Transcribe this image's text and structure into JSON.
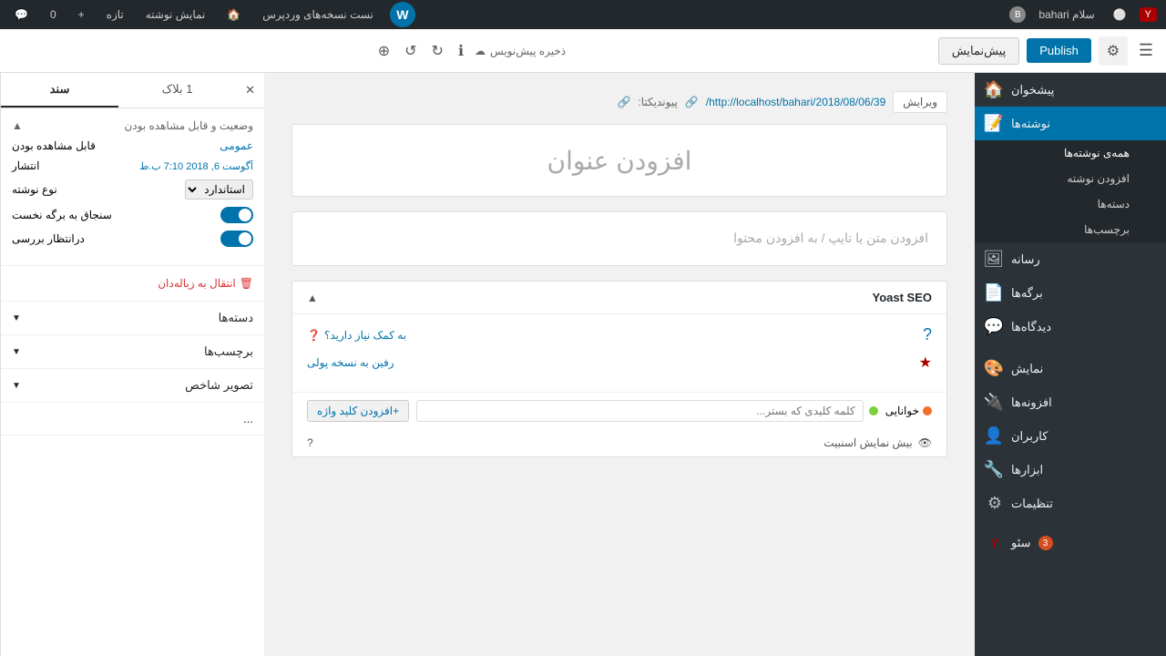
{
  "admin_bar": {
    "wp_logo": "W",
    "site_name": "نست نسخه‌های وردپرس",
    "home_icon": "🏠",
    "view_site": "نمایش نوشته",
    "customize": "تازه",
    "comment_count": "0",
    "plus_label": "+",
    "user_name": "سلام bahari",
    "user_avatar": "B",
    "yoast_icon": "Y",
    "circle_icon": "⚪"
  },
  "editor_toolbar": {
    "hamburger": "☰",
    "settings_label": "⚙",
    "publish_label": "Publish",
    "preview_label": "پیش‌نمایش",
    "save_label": "ذخیره پیش‌نویس",
    "cloud_icon": "☁",
    "info_icon": "ℹ",
    "redo_icon": "↻",
    "undo_icon": "↺",
    "plus_icon": "⊕"
  },
  "sidebar": {
    "items": [
      {
        "id": "dashboard",
        "label": "پیشخوان",
        "icon": "🏠",
        "active": false
      },
      {
        "id": "posts",
        "label": "نوشته‌ها",
        "icon": "📝",
        "active": true
      },
      {
        "id": "media",
        "label": "رسانه",
        "icon": "🖼",
        "active": false
      },
      {
        "id": "pages",
        "label": "برگه‌ها",
        "icon": "📄",
        "active": false
      },
      {
        "id": "comments",
        "label": "دیدگاه‌ها",
        "icon": "💬",
        "active": false
      },
      {
        "id": "appearance",
        "label": "نمایش",
        "icon": "🎨",
        "active": false
      },
      {
        "id": "plugins",
        "label": "افزونه‌ها",
        "icon": "🔌",
        "active": false
      },
      {
        "id": "users",
        "label": "کاربران",
        "icon": "👤",
        "active": false
      },
      {
        "id": "tools",
        "label": "ابزارها",
        "icon": "🔧",
        "active": false
      },
      {
        "id": "settings",
        "label": "تنظیمات",
        "icon": "⚙",
        "active": false
      },
      {
        "id": "seo",
        "label": "سئو",
        "icon": "Y",
        "active": false,
        "badge": "3"
      }
    ],
    "posts_submenu": [
      {
        "id": "all-posts",
        "label": "همه‌ی نوشته‌ها",
        "active": true
      },
      {
        "id": "add-new",
        "label": "افزودن نوشته",
        "active": false
      },
      {
        "id": "categories",
        "label": "دسته‌ها",
        "active": false
      },
      {
        "id": "tags",
        "label": "برچسب‌ها",
        "active": false
      }
    ]
  },
  "panel": {
    "tab_document": "سند",
    "tab_block": "1 بلاک",
    "close_icon": "✕",
    "status_section": {
      "title": "وضعیت و قابل مشاهده بودن",
      "visibility_label": "قابل مشاهده بودن",
      "visibility_value": "عمومی",
      "publish_label": "انتشار",
      "publish_value": "آگوست 6, 2018 7:10 ب.ط",
      "post_type_label": "نوع نوشته",
      "post_type_value": "استاندارد ▼",
      "stick_label": "سنجاق به برگه نخست",
      "pending_label": "درانتظار بررسی"
    },
    "trash_label": "انتقال به زباله‌دان",
    "categories_label": "دسته‌ها",
    "tags_label": "برچسب‌ها",
    "image_label": "تصویر شاخص"
  },
  "editor": {
    "permalink_label": "پیوندیکتا:",
    "permalink_url": "http://localhost/bahari/2018/08/06/39/",
    "link_icon": "🔗",
    "external_icon": "🔗",
    "edit_btn": "ویرایش",
    "title_placeholder": "افزودن عنوان",
    "content_placeholder": "افزودن متن یا تایپ / به افزودن محتوا"
  },
  "yoast": {
    "title": "Yoast SEO",
    "toggle_arrow": "▲",
    "need_help_label": "به کمک نیاز دارید؟",
    "help_icon": "?",
    "star_icon": "★",
    "version_link": "رفین به نسخه پولی",
    "readability_label": "خوانایی",
    "readability_status": "orange",
    "keyword_label": "کلمه کلیدی که بستر...",
    "keyword_placeholder": "کلمه کلیدی که بستر...",
    "add_keyword_label": "+افزودن کلید واژه",
    "preview_label": "بیش نمایش اسنبیت",
    "preview_icon": "👁",
    "question_icon": "?"
  }
}
